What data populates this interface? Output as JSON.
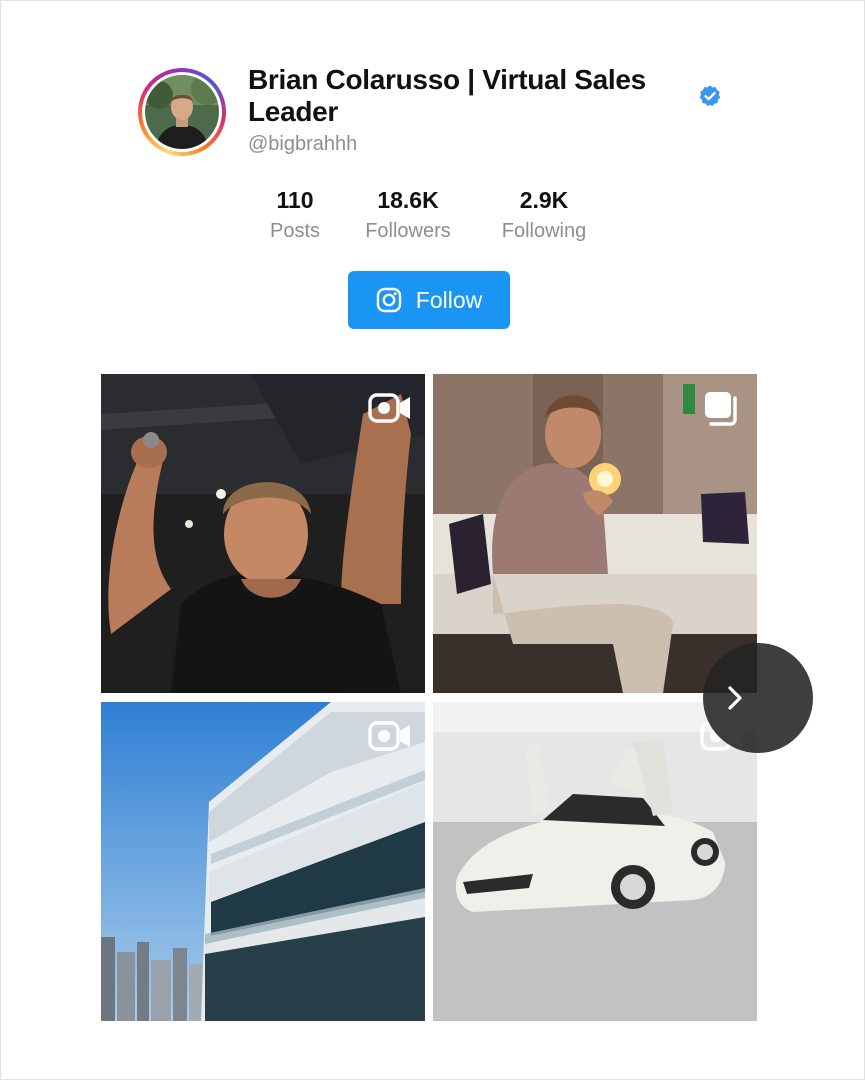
{
  "profile": {
    "name": "Brian Colarusso | Virtual Sales Leader",
    "handle": "@bigbrahhh",
    "verified": true,
    "avatar_icon": "profile-photo"
  },
  "stats": [
    {
      "value": "110",
      "label": "Posts"
    },
    {
      "value": "18.6K",
      "label": "Followers"
    },
    {
      "value": "2.9K",
      "label": "Following"
    }
  ],
  "follow_button": {
    "label": "Follow",
    "icon": "instagram-icon",
    "color": "#1b95f4"
  },
  "posts": [
    {
      "type": "video",
      "badge_icon": "video-camera-icon",
      "subject": "man flexing arm in gym"
    },
    {
      "type": "carousel",
      "badge_icon": "multiple-images-icon",
      "subject": "man lighting cigar on sofa"
    },
    {
      "type": "video",
      "badge_icon": "video-camera-icon",
      "subject": "high-rise building balcony"
    },
    {
      "type": "video",
      "badge_icon": "video-camera-icon",
      "subject": "white sports car with scissor doors"
    }
  ],
  "carousel": {
    "next_icon": "chevron-right-icon"
  },
  "colors": {
    "verified": "#3897f0",
    "secondary_text": "#8e8e8e"
  }
}
